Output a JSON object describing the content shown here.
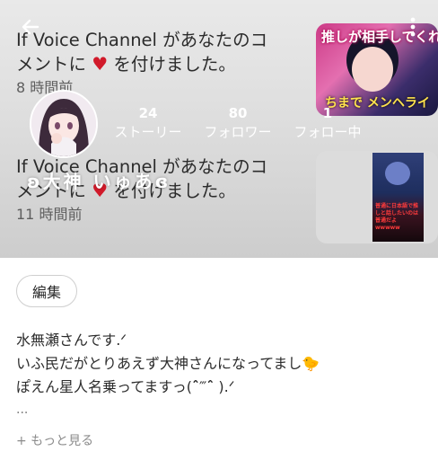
{
  "notifications": [
    {
      "line1": "If Voice Channel があなたのコ",
      "line2a": "メントに",
      "heart": "♥",
      "line2b": "を付けました。",
      "time": "8 時間前",
      "thumb_caption": "推しが相手してくれな",
      "thumb_caption2": "ちまで メンヘライ"
    },
    {
      "line1": "If Voice Channel があなたのコ",
      "line2a": "メントに",
      "heart": "♥",
      "line2b": "を付けました。",
      "time": "11 時間前",
      "thumb_caption": "普通に日本語で推しと話したいのは 普通だよwwwww"
    }
  ],
  "profile": {
    "username": "ʚ大神 いゅあɞ",
    "stats": [
      {
        "value": "24",
        "label": "ストーリー"
      },
      {
        "value": "80",
        "label": "フォロワー"
      },
      {
        "value": "1",
        "label": "フォロー中"
      }
    ]
  },
  "actions": {
    "edit_label": "編集"
  },
  "bio": {
    "line1": "水無瀬さんです.ᐟ",
    "line2": "いふ民だがとりあえず大神さんになってまし",
    "line2_emoji": "🐤",
    "line3": "ぽえん星人名乗ってますっ(ˆ̑‴ˆ̑ ).ᐟ",
    "ellipsis": "...",
    "more": "+ もっと見る"
  },
  "icons": {
    "back": "back-arrow-icon",
    "more": "more-vertical-icon",
    "heart": "heart-icon"
  },
  "colors": {
    "heart": "#d11a2a",
    "header_bg": "#dedede"
  }
}
